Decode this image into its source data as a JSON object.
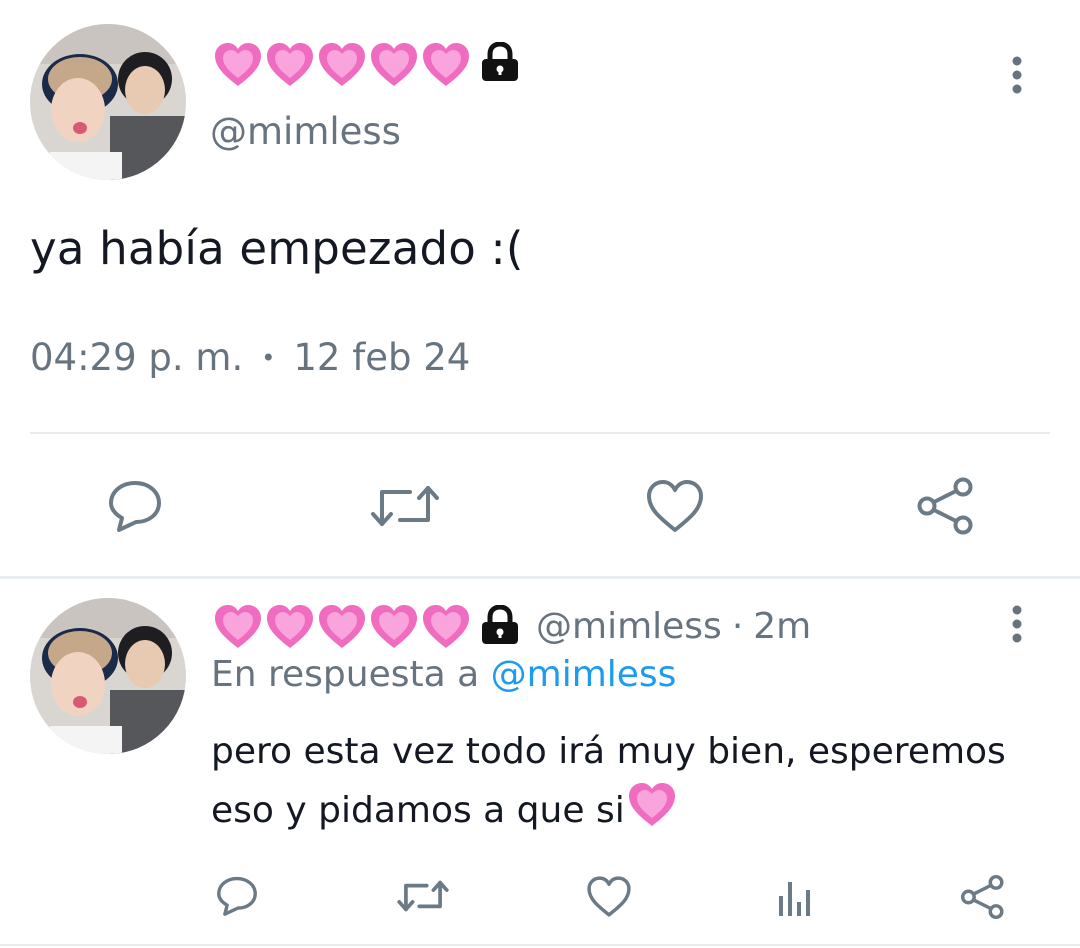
{
  "main_tweet": {
    "handle": "@mimless",
    "text": "ya había empezado :(",
    "time": "04:29 p. m.",
    "separator": "•",
    "date": "12 feb 24",
    "heart_count": 5
  },
  "reply_tweet": {
    "handle": "@mimless",
    "separator": "·",
    "age": "2m",
    "reply_prefix": "En respuesta a ",
    "reply_handle": "@mimless",
    "text": "pero esta vez todo irá muy bien, esperemos eso y pidamos a que si",
    "heart_count": 5
  },
  "colors": {
    "secondary_text": "#67747f",
    "link": "#1d9bf0",
    "icon": "#6a7a86",
    "heart_emoji": "#f06cc0"
  },
  "icons": {
    "more": "more-vertical-icon",
    "reply": "comment-icon",
    "retweet": "retweet-icon",
    "like": "heart-outline-icon",
    "views": "analytics-icon",
    "share": "share-icon"
  }
}
